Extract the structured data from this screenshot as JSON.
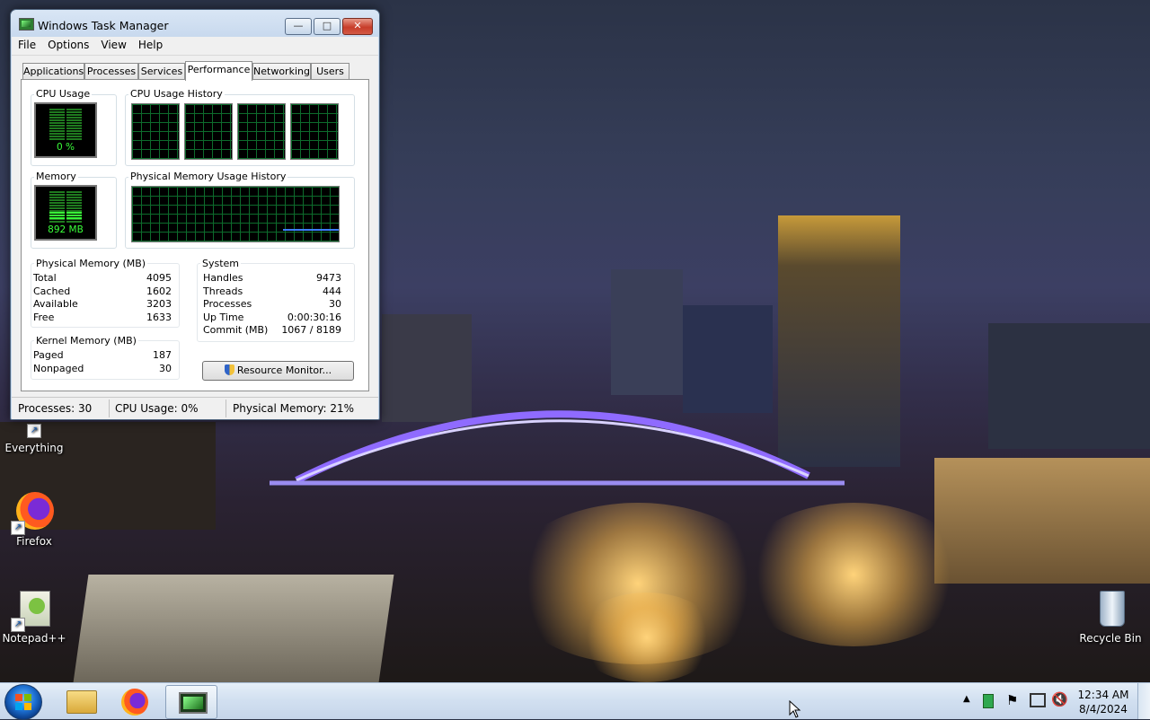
{
  "window": {
    "title": "Windows Task Manager",
    "menu": [
      "File",
      "Options",
      "View",
      "Help"
    ],
    "tabs": [
      "Applications",
      "Processes",
      "Services",
      "Performance",
      "Networking",
      "Users"
    ],
    "active_tab": "Performance",
    "cpu_usage": {
      "label": "CPU Usage",
      "value": "0 %",
      "level": 0
    },
    "cpu_history": {
      "label": "CPU Usage History"
    },
    "memory": {
      "label": "Memory",
      "value": "892 MB",
      "level": 0.21
    },
    "memory_history": {
      "label": "Physical Memory Usage History"
    },
    "physical_memory": {
      "title": "Physical Memory (MB)",
      "rows": [
        {
          "k": "Total",
          "v": "4095"
        },
        {
          "k": "Cached",
          "v": "1602"
        },
        {
          "k": "Available",
          "v": "3203"
        },
        {
          "k": "Free",
          "v": "1633"
        }
      ]
    },
    "kernel_memory": {
      "title": "Kernel Memory (MB)",
      "rows": [
        {
          "k": "Paged",
          "v": "187"
        },
        {
          "k": "Nonpaged",
          "v": "30"
        }
      ]
    },
    "system": {
      "title": "System",
      "rows": [
        {
          "k": "Handles",
          "v": "9473"
        },
        {
          "k": "Threads",
          "v": "444"
        },
        {
          "k": "Processes",
          "v": "30"
        },
        {
          "k": "Up Time",
          "v": "0:00:30:16"
        },
        {
          "k": "Commit (MB)",
          "v": "1067 / 8189"
        }
      ]
    },
    "resource_monitor_button": "Resource Monitor...",
    "status": {
      "processes": "Processes: 30",
      "cpu": "CPU Usage: 0%",
      "memory": "Physical Memory: 21%"
    }
  },
  "desktop_icons": [
    {
      "label": "Everything",
      "icon": "everything-icon"
    },
    {
      "label": "Firefox",
      "icon": "firefox-icon"
    },
    {
      "label": "Notepad++",
      "icon": "notepadpp-icon"
    },
    {
      "label": "Recycle Bin",
      "icon": "recycle-bin-icon"
    }
  ],
  "taskbar": {
    "apps": [
      "file-explorer-icon",
      "firefox-icon",
      "task-manager-icon"
    ],
    "clock_time": "12:34 AM",
    "clock_date": "8/4/2024"
  },
  "colors": {
    "graph_green": "#38ff38",
    "grid_green": "#0d6b2c",
    "memory_line": "#3d7cff",
    "window_frame": "#c3d6ec"
  }
}
